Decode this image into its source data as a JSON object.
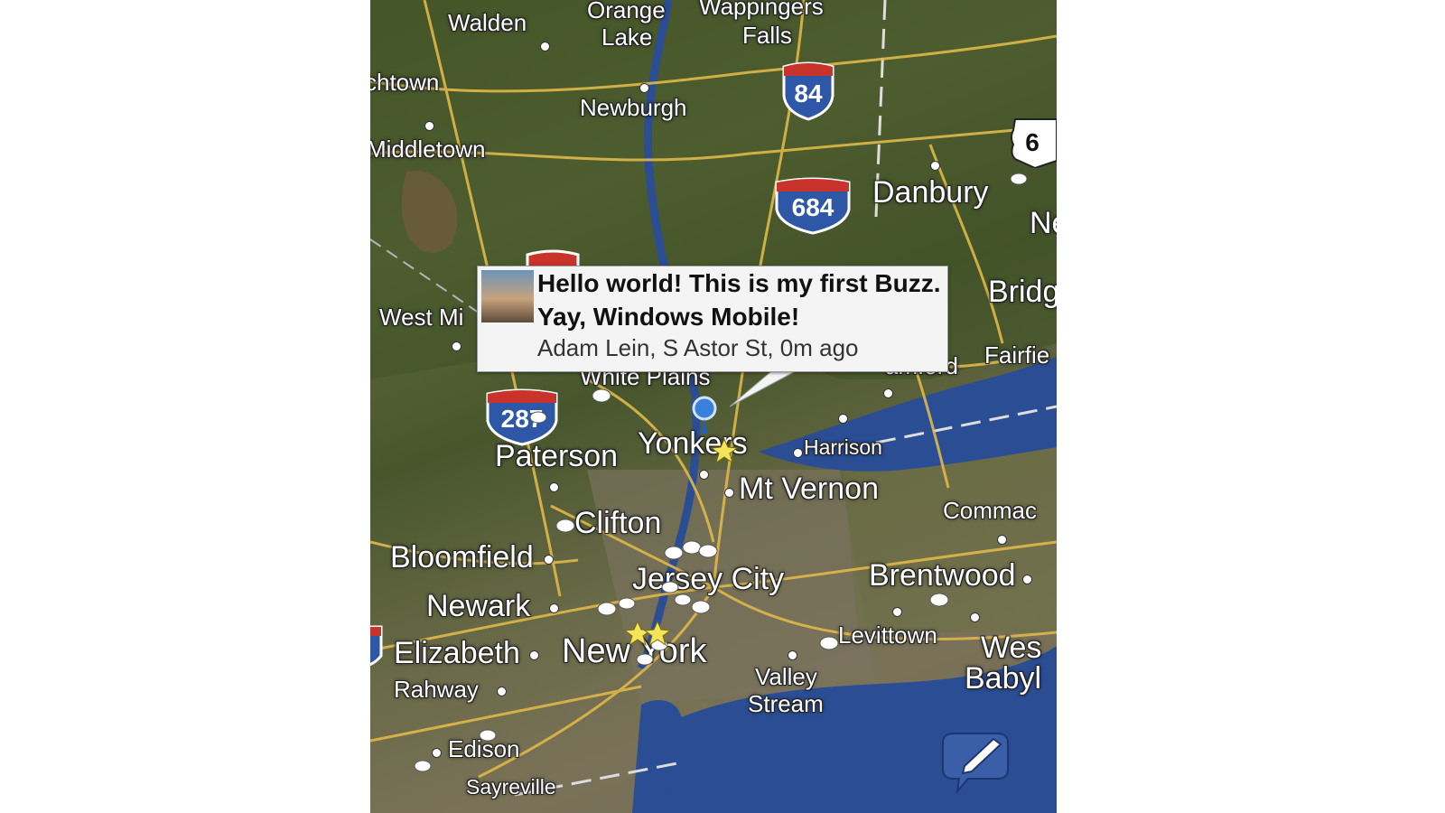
{
  "map": {
    "places": [
      {
        "name": "Walden"
      },
      {
        "name": "Orange"
      },
      {
        "name": "Lake"
      },
      {
        "name": "Wappingers"
      },
      {
        "name": "Falls"
      },
      {
        "name": "chtown"
      },
      {
        "name": "Newburgh"
      },
      {
        "name": "Middletown"
      },
      {
        "name": "Danbury"
      },
      {
        "name": "Ne"
      },
      {
        "name": "Bridg"
      },
      {
        "name": "West Mi"
      },
      {
        "name": "Fairfie"
      },
      {
        "name": "White Plains"
      },
      {
        "name": "amford"
      },
      {
        "name": "Yonkers"
      },
      {
        "name": "Harrison"
      },
      {
        "name": "Paterson"
      },
      {
        "name": "Mt Vernon"
      },
      {
        "name": "Commac"
      },
      {
        "name": "Clifton"
      },
      {
        "name": "Bloomfield"
      },
      {
        "name": "Jersey City"
      },
      {
        "name": "Brentwood"
      },
      {
        "name": "Newark"
      },
      {
        "name": "Levittown"
      },
      {
        "name": "Elizabeth"
      },
      {
        "name": "New York"
      },
      {
        "name": "Wes"
      },
      {
        "name": "Babyl"
      },
      {
        "name": "Rahway"
      },
      {
        "name": "Valley"
      },
      {
        "name": "Stream"
      },
      {
        "name": "Edison"
      },
      {
        "name": "Sayreville"
      }
    ],
    "highways": [
      {
        "number": "84",
        "type": "interstate"
      },
      {
        "number": "684",
        "type": "interstate"
      },
      {
        "number": "287",
        "type": "interstate"
      },
      {
        "number": "6",
        "type": "us-route"
      }
    ]
  },
  "popup": {
    "message": "Hello world! This is my first Buzz. Yay, Windows Mobile!",
    "meta": "Adam Lein, S Astor St, 0m ago"
  },
  "compose_button": {
    "icon": "compose-buzz-icon",
    "color": "#3a5ea8"
  },
  "colors": {
    "water": "#2b4d94",
    "road": "#e0b84a",
    "interstate_blue": "#2f57a8",
    "interstate_red": "#c8332b"
  }
}
